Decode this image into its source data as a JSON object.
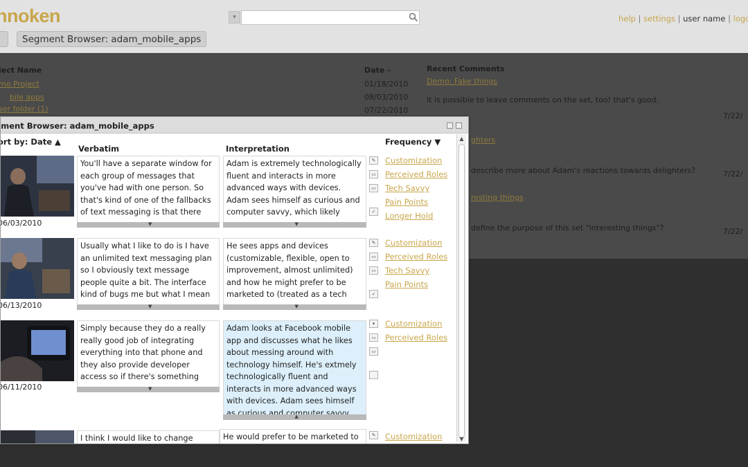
{
  "app": {
    "logo": "hnoken"
  },
  "search": {
    "placeholder": "",
    "value": ""
  },
  "toplinks": {
    "help": "help",
    "settings": "settings",
    "username": "user name",
    "logout": "logo"
  },
  "tab": {
    "label": "Segment Browser: adam_mobile_apps"
  },
  "background": {
    "project_header": "ject Name",
    "demo_project": "mo Project",
    "row1": "bile apps",
    "row2": "ser folder (1)",
    "date_header": "Date -",
    "dates": [
      "01/18/2010",
      "08/03/2010",
      "07/22/2010"
    ],
    "recent_comments": "Recent Comments",
    "comment1_link": "Demo: Fake things",
    "comment1_text": "It is possible to leave comments on the set, too! that's good.",
    "comment1_date": "7/22/",
    "comment2_link": "ghters",
    "comment2_text": "describe more about Adam's reactions towards delighters?",
    "comment2_date": "7/22/",
    "comment3_link": "resting things",
    "comment3_text": "define the purpose of this set \"interesting things\"?",
    "comment3_date": "7/22/"
  },
  "window": {
    "title": "gment Browser: adam_mobile_apps",
    "sort_label": "ort by:",
    "sort_value": "Date",
    "col_verbatim": "Verbatim",
    "col_interpretation": "Interpretation",
    "col_frequency": "Frequency",
    "rows": [
      {
        "date": "06/03/2010",
        "verbatim": "You'll have a separate window for each group of messages that you've had with one person. So that's kind of one of the fallbacks of text messaging is that there",
        "interpretation": "Adam is extremely technologically fluent and interacts in more advanced ways with devices. Adam sees himself as curious and computer savvy, which likely",
        "tags": [
          "Customization",
          "Perceived Roles",
          "Tech Savvy",
          "Pain Points",
          "Longer Hold"
        ]
      },
      {
        "date": "06/13/2010",
        "verbatim": "Usually what I like to do is I have an unlimited text messaging plan so I obviously text message people quite a bit. The interface kind of bugs me but what I mean",
        "interpretation": "He sees apps and devices (customizable, flexible, open to improvement, almost unlimited) and how he might prefer to be marketed to (treated as a tech",
        "tags": [
          "Customization",
          "Perceived Roles",
          "Tech Savvy",
          "Pain Points"
        ]
      },
      {
        "date": "06/11/2010",
        "verbatim": "Simply because they do a really really good job of integrating everything into that phone and they also provide developer access so if there's something",
        "interpretation": "Adam looks at Facebook mobile app and discusses what he likes about messing around with technology himself. He's extmely technologically fluent and interacts in more advanced ways with devices. Adam sees himself as curious and computer savvy.",
        "tags": [
          "Customization",
          "Perceived Roles"
        ]
      },
      {
        "date": "",
        "verbatim": "I think I would like to change",
        "interpretation": "He would prefer to be marketed to",
        "tags": [
          "Customization"
        ]
      }
    ]
  }
}
